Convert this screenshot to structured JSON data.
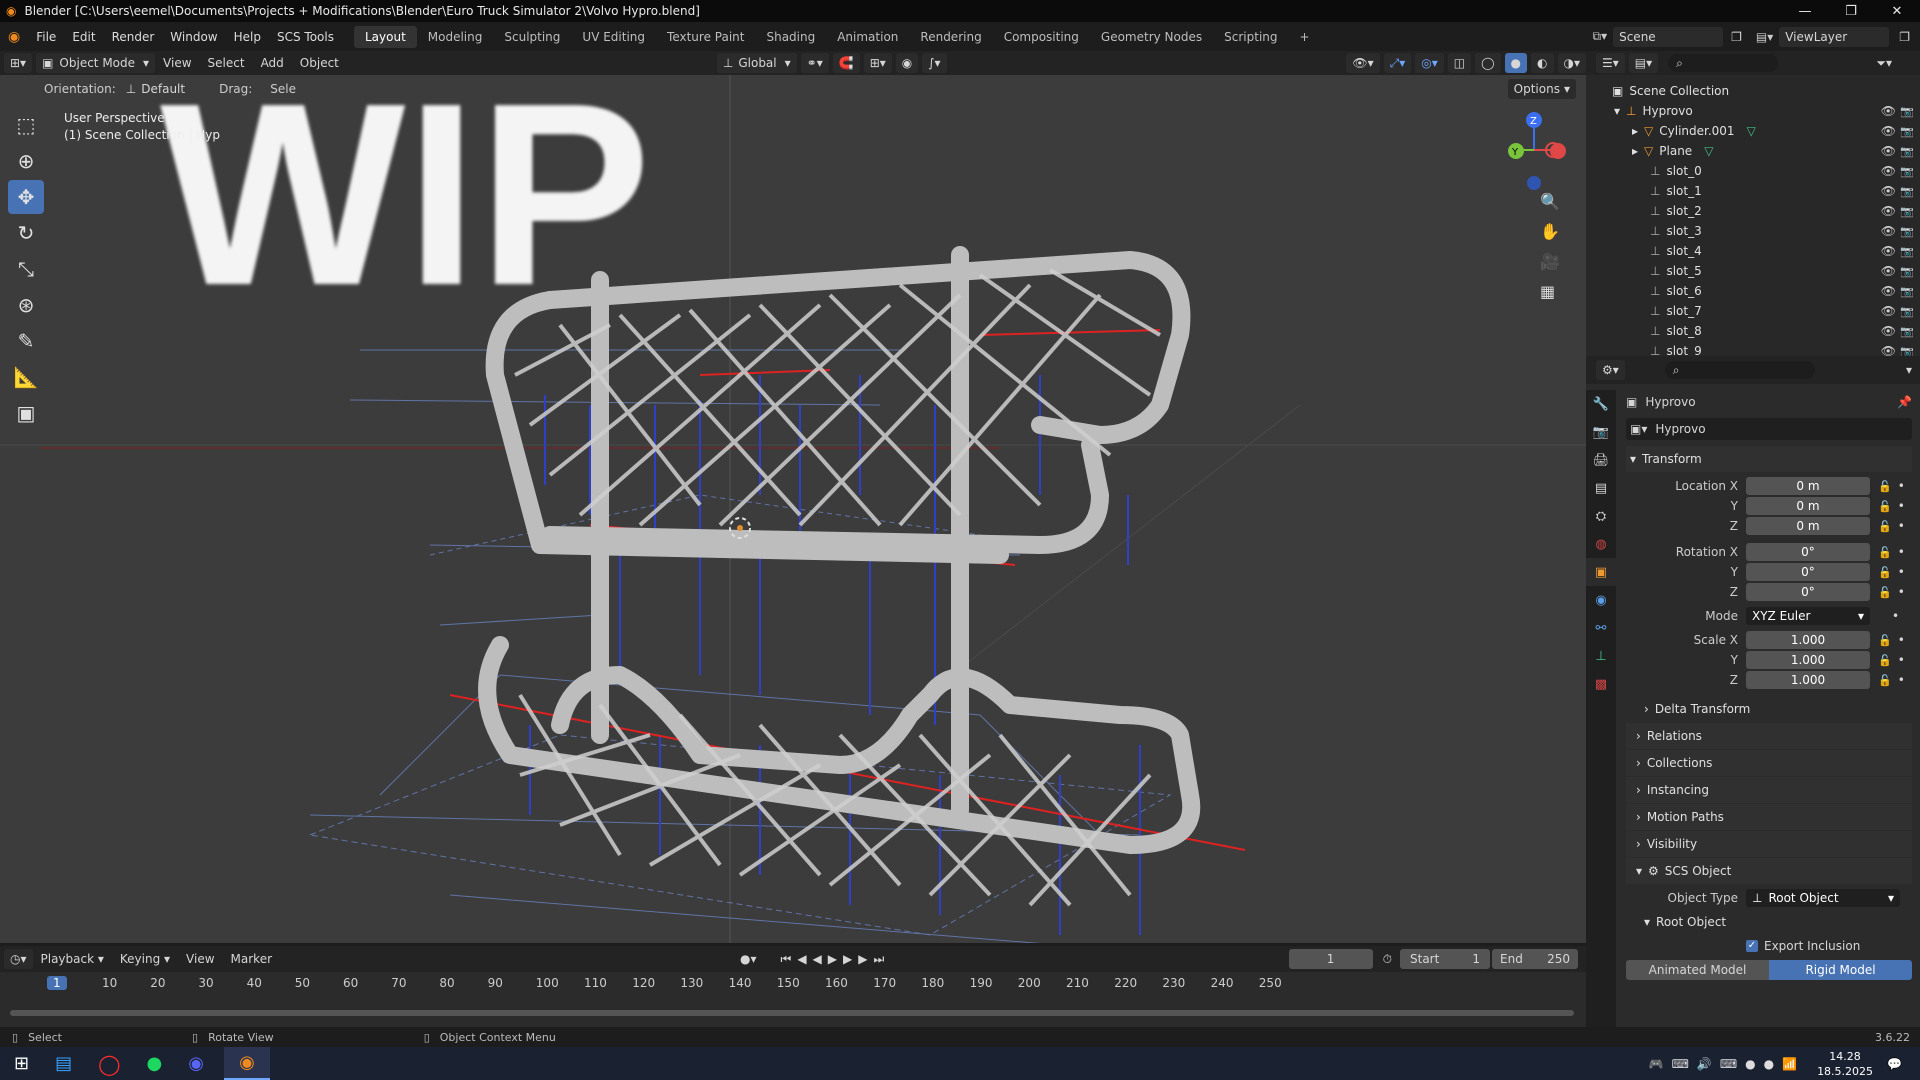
{
  "window": {
    "title": "Blender [C:\\Users\\eemel\\Documents\\Projects + Modifications\\Blender\\Euro Truck Simulator 2\\Volvo Hypro.blend]",
    "controls": [
      "—",
      "❐",
      "✕"
    ]
  },
  "menubar": {
    "menus": [
      "File",
      "Edit",
      "Render",
      "Window",
      "Help",
      "SCS Tools"
    ],
    "workspaces": [
      "Layout",
      "Modeling",
      "Sculpting",
      "UV Editing",
      "Texture Paint",
      "Shading",
      "Animation",
      "Rendering",
      "Compositing",
      "Geometry Nodes",
      "Scripting"
    ],
    "active_workspace": "Layout",
    "scene": "Scene",
    "view_layer": "ViewLayer"
  },
  "viewport_header": {
    "mode": "Object Mode",
    "menus": [
      "View",
      "Select",
      "Add",
      "Object"
    ],
    "transform_orientation": "Global",
    "options": "Options"
  },
  "tool_settings": {
    "orientation_label": "Orientation:",
    "orientation_value": "Default",
    "drag_label": "Drag:",
    "drag_value": "Sele"
  },
  "viewport": {
    "overlay_line1": "User Perspective",
    "overlay_line2": "(1) Scene Collection | Hyp",
    "watermark": "WIP",
    "background": "#3c3c3c"
  },
  "gizmo": {
    "z": "Z",
    "y": "Y",
    "x": "X"
  },
  "tools": [
    "select-box",
    "cursor",
    "move",
    "rotate",
    "scale",
    "transform",
    "annotate",
    "measure",
    "add-cube"
  ],
  "outliner": {
    "root": "Scene Collection",
    "items": [
      {
        "label": "Hyprovo",
        "level": 1,
        "expanded": true
      },
      {
        "label": "Cylinder.001",
        "level": 2,
        "expanded": false
      },
      {
        "label": "Plane",
        "level": 2,
        "expanded": false
      },
      {
        "label": "slot_0",
        "level": 2
      },
      {
        "label": "slot_1",
        "level": 2
      },
      {
        "label": "slot_2",
        "level": 2
      },
      {
        "label": "slot_3",
        "level": 2
      },
      {
        "label": "slot_4",
        "level": 2
      },
      {
        "label": "slot_5",
        "level": 2
      },
      {
        "label": "slot_6",
        "level": 2
      },
      {
        "label": "slot_7",
        "level": 2
      },
      {
        "label": "slot_8",
        "level": 2
      },
      {
        "label": "slot_9",
        "level": 2
      }
    ]
  },
  "properties": {
    "object_name": "Hyprovo",
    "data_name": "Hyprovo",
    "transform_title": "Transform",
    "location": {
      "label": "Location X",
      "x": "0 m",
      "y": "0 m",
      "z": "0 m"
    },
    "rotation": {
      "label": "Rotation X",
      "x": "0°",
      "y": "0°",
      "z": "0°"
    },
    "mode_label": "Mode",
    "mode_value": "XYZ Euler",
    "scale": {
      "label": "Scale X",
      "x": "1.000",
      "y": "1.000",
      "z": "1.000"
    },
    "axis_y": "Y",
    "axis_z": "Z",
    "sections": [
      "Delta Transform",
      "Relations",
      "Collections",
      "Instancing",
      "Motion Paths",
      "Visibility"
    ],
    "scs_object": "SCS Object",
    "object_type_label": "Object Type",
    "object_type_value": "Root Object",
    "root_object": "Root Object",
    "export_inclusion": "Export Inclusion",
    "animated_model": "Animated Model",
    "rigid_model": "Rigid Model"
  },
  "timeline": {
    "menus": [
      "Playback",
      "Keying",
      "View",
      "Marker"
    ],
    "current_frame": "1",
    "start_label": "Start",
    "start": "1",
    "end_label": "End",
    "end": "250",
    "ticks": [
      "1",
      "10",
      "20",
      "30",
      "40",
      "50",
      "60",
      "70",
      "80",
      "90",
      "100",
      "110",
      "120",
      "130",
      "140",
      "150",
      "160",
      "170",
      "180",
      "190",
      "200",
      "210",
      "220",
      "230",
      "240",
      "250"
    ]
  },
  "statusbar": {
    "select": "Select",
    "rotate": "Rotate View",
    "context": "Object Context Menu",
    "version": "3.6.22"
  },
  "taskbar": {
    "time": "14.28",
    "date": "18.5.2025"
  }
}
